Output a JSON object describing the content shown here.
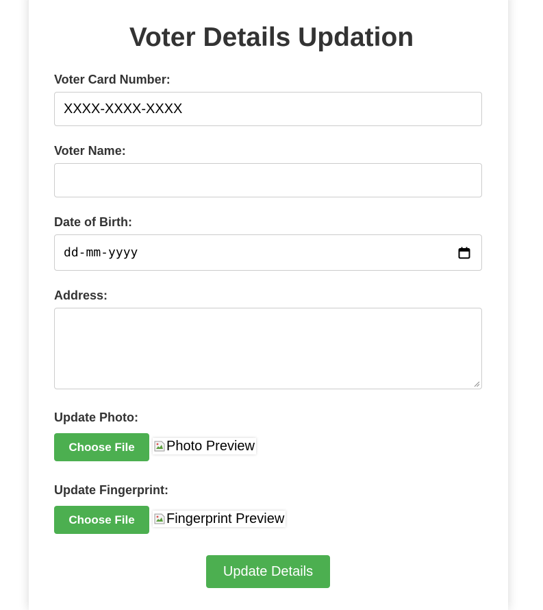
{
  "page": {
    "title": "Voter Details Updation",
    "accent_color": "#4caf50"
  },
  "form": {
    "voter_card": {
      "label": "Voter Card Number:",
      "value": "XXXX-XXXX-XXXX"
    },
    "voter_name": {
      "label": "Voter Name:",
      "value": ""
    },
    "dob": {
      "label": "Date of Birth:",
      "placeholder": "dd-mm-yyyy",
      "icon": "calendar-icon"
    },
    "address": {
      "label": "Address:",
      "value": ""
    },
    "photo": {
      "label": "Update Photo:",
      "button_label": "Choose File",
      "preview_alt": "Photo Preview",
      "preview_icon": "broken-image-icon"
    },
    "fingerprint": {
      "label": "Update Fingerprint:",
      "button_label": "Choose File",
      "preview_alt": "Fingerprint Preview",
      "preview_icon": "broken-image-icon"
    },
    "submit_label": "Update Details"
  }
}
